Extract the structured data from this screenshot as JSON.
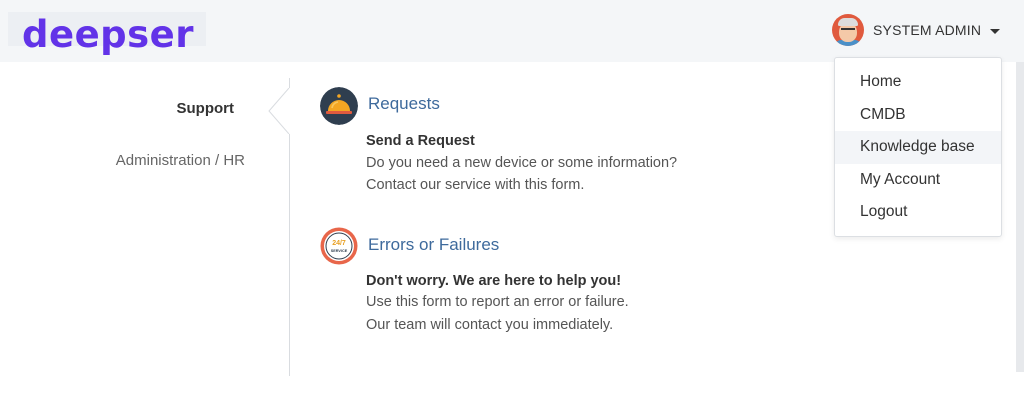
{
  "header": {
    "logo_text": "deepser",
    "user_name": "SYSTEM ADMIN"
  },
  "user_menu": {
    "items": [
      {
        "label": "Home"
      },
      {
        "label": "CMDB"
      },
      {
        "label": "Knowledge base"
      },
      {
        "label": "My Account"
      },
      {
        "label": "Logout"
      }
    ],
    "highlighted_index": 2
  },
  "sidebar": {
    "items": [
      {
        "label": "Support",
        "active": true
      },
      {
        "label": "Administration / HR",
        "active": false
      }
    ]
  },
  "services": [
    {
      "title": "Requests",
      "subtitle": "Send a Request",
      "line1": "Do you need a new device or some information?",
      "line2": "Contact our service with this form.",
      "icon": "service-bell-icon"
    },
    {
      "title": "Errors or Failures",
      "subtitle": "Don't worry. We are here to help you!",
      "line1": "Use this form to report an error or failure.",
      "line2": "Our team will contact you immediately.",
      "icon": "24-7-service-icon",
      "icon_text_top": "24/7",
      "icon_text_bottom": "SERVICE"
    }
  ],
  "colors": {
    "brand": "#6233e8",
    "link": "#3e6a9c",
    "header_bg": "#f4f6f8"
  }
}
